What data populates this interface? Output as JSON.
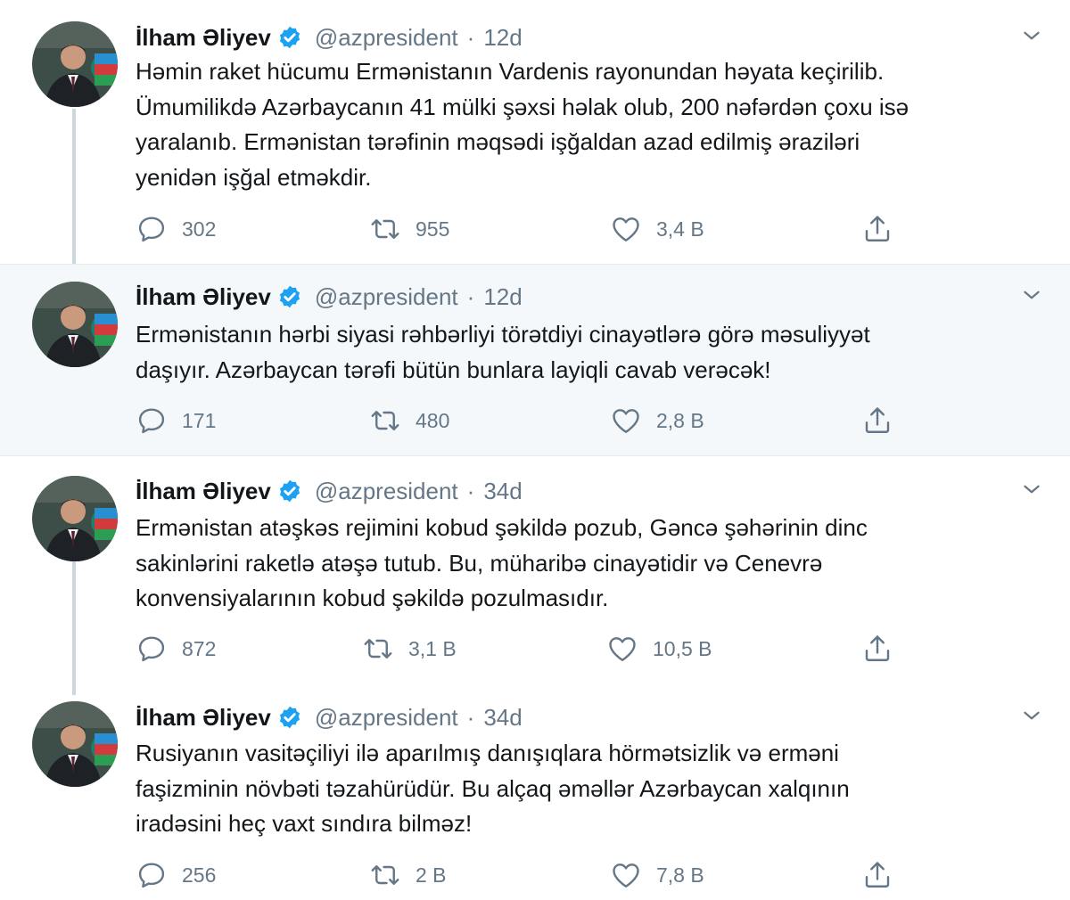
{
  "tweets": [
    {
      "author": "İlham Əliyev",
      "handle": "@azpresident",
      "separator": "·",
      "time": "12d",
      "lines": [
        "Həmin raket hücumu Ermənistanın Vardenis rayonundan həyata keçirilib.",
        "Ümumilikdə Azərbaycanın 41 mülki şəxsi həlak olub, 200 nəfərdən çoxu isə",
        "yaralanıb. Ermənistan tərəfinin məqsədi işğaldan azad edilmiş əraziləri",
        "yenidən işğal etməkdir."
      ],
      "replies": "302",
      "retweets": "955",
      "likes": "3,4 B"
    },
    {
      "author": "İlham Əliyev",
      "handle": "@azpresident",
      "separator": "·",
      "time": "12d",
      "lines": [
        "Ermənistanın hərbi siyasi rəhbərliyi törətdiyi cinayətlərə görə məsuliyyət",
        "daşıyır. Azərbaycan tərəfi bütün bunlara layiqli cavab verəcək!"
      ],
      "replies": "171",
      "retweets": "480",
      "likes": "2,8 B"
    },
    {
      "author": "İlham Əliyev",
      "handle": "@azpresident",
      "separator": "·",
      "time": "34d",
      "lines": [
        "Ermənistan atəşkəs rejimini kobud şəkildə pozub, Gəncə şəhərinin dinc",
        "sakinlərini raketlə atəşə tutub. Bu, müharibə cinayətidir və Cenevrə",
        "konvensiyalarının kobud şəkildə pozulmasıdır."
      ],
      "replies": "872",
      "retweets": "3,1 B",
      "likes": "10,5 B"
    },
    {
      "author": "İlham Əliyev",
      "handle": "@azpresident",
      "separator": "·",
      "time": "34d",
      "lines": [
        "Rusiyanın vasitəçiliyi ilə aparılmış danışıqlara hörmətsizlik və erməni",
        "faşizminin növbəti təzahürüdür. Bu alçaq əməllər Azərbaycan xalqının",
        "iradəsini heç vaxt sındıra bilməz!"
      ],
      "replies": "256",
      "retweets": "2 B",
      "likes": "7,8 B"
    }
  ],
  "colors": {
    "text": "#14171a",
    "secondary": "#657786",
    "verified": "#1da1f2",
    "highlight_bg": "#f5f8fa",
    "thread_line": "#ccd6dd",
    "divider": "#e6ecf0"
  },
  "icons": {
    "verified": "verified-badge-icon",
    "menu": "chevron-down-icon",
    "reply": "reply-icon",
    "retweet": "retweet-icon",
    "like": "heart-icon",
    "share": "share-icon"
  }
}
